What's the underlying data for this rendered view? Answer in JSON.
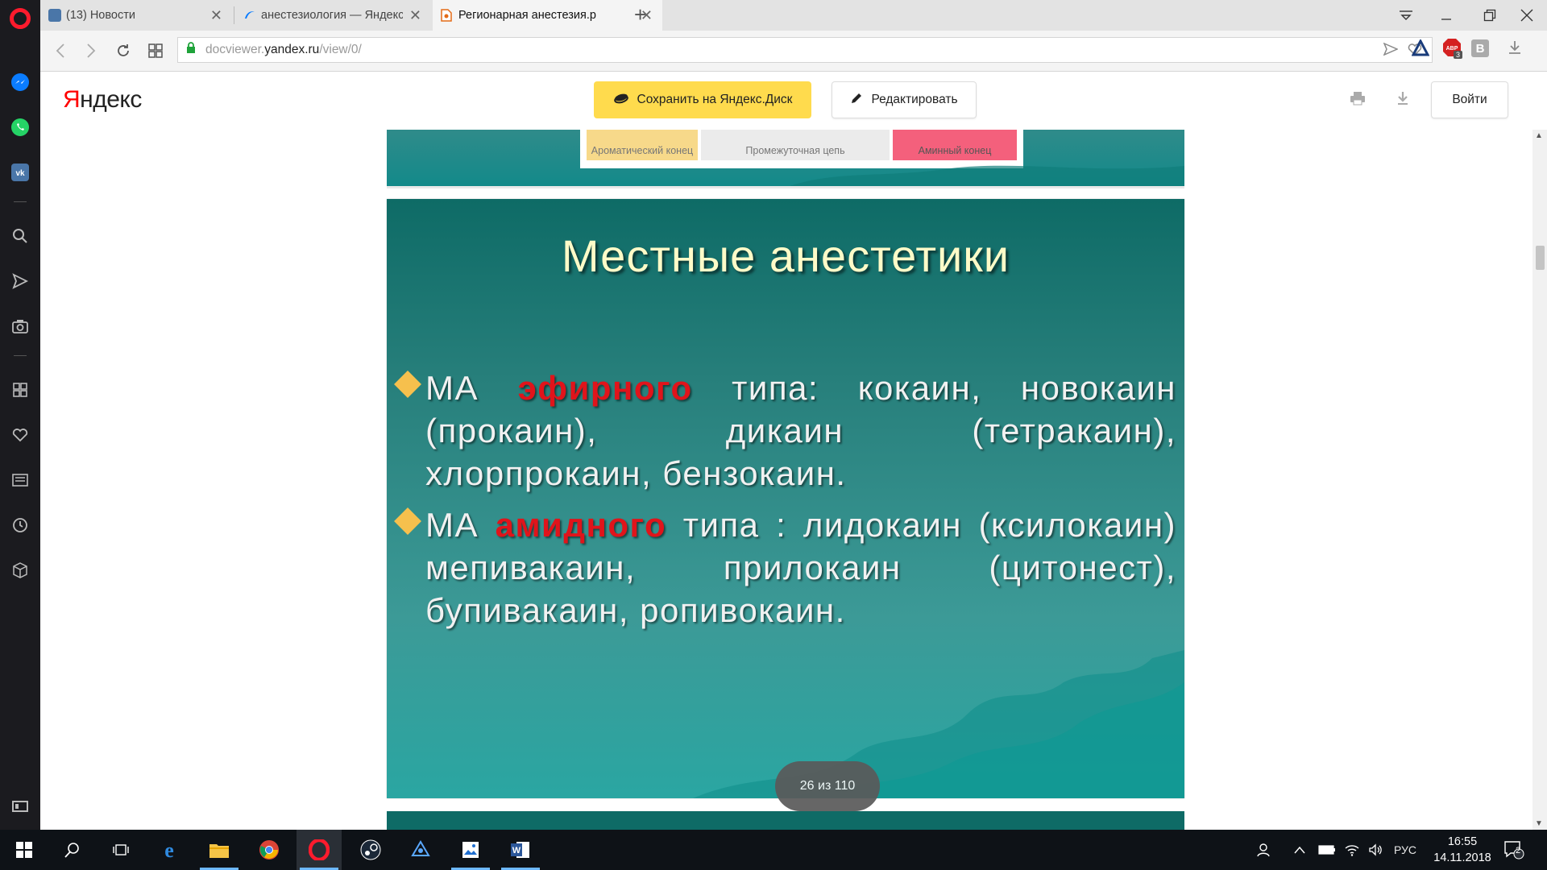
{
  "browser": {
    "tabs": [
      {
        "title": "(13) Новости",
        "favicon": "vk-icon"
      },
      {
        "title": "анестезиология — Яндекс",
        "favicon": "yandex-icon"
      },
      {
        "title": "Регионарная анестезия.p",
        "favicon": "docviewer-icon"
      }
    ],
    "url_scheme": "docviewer.",
    "url_host": "yandex.ru",
    "url_path": "/view/0/",
    "adblock_count": "3",
    "ext_letter": "В"
  },
  "app": {
    "logo_first": "Я",
    "logo_rest": "ндекс",
    "save_label": "Сохранить на Яндекс.Диск",
    "edit_label": "Редактировать",
    "login_label": "Войти"
  },
  "prev_slide": {
    "aromatic": "Ароматический конец",
    "chain": "Промежуточная цепь",
    "amine": "Аминный конец"
  },
  "slide": {
    "title": "Местные анестетики",
    "bullet1_prefix": "МА ",
    "bullet1_emph": "эфирного",
    "bullet1_rest": " типа: кокаин, новокаин (прокаин), дикаин (тетракаин), хлорпрокаин, бензокаин.",
    "bullet2_prefix": "МА ",
    "bullet2_emph": "амидного",
    "bullet2_rest": " типа : лидокаин (ксилокаин) мепивакаин, прилокаин (цитонест), бупивакаин, ропивокаин."
  },
  "pager": "26 из 110",
  "taskbar": {
    "lang": "РУС",
    "time": "16:55",
    "date": "14.11.2018",
    "notifications": "2"
  },
  "colors": {
    "accent_yellow": "#ffdb4d",
    "slide_title": "#fffbc8",
    "emphasis_red": "#e0141b",
    "bullet_diamond": "#f6c04d"
  }
}
